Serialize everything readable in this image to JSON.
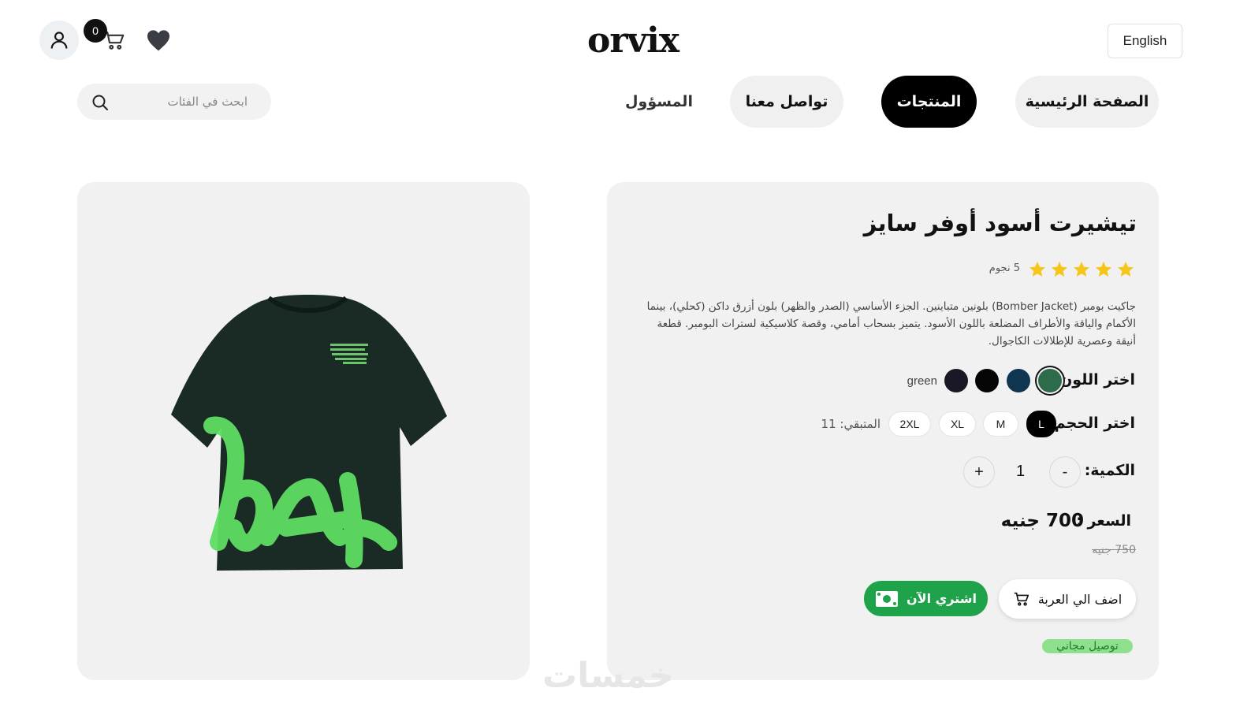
{
  "header": {
    "cart_count": "0",
    "logo": "orvix",
    "language": "English"
  },
  "nav": {
    "home": "الصفحة الرئيسية",
    "products": "المنتجات",
    "contact": "تواصل معنا",
    "admin": "المسؤول",
    "active": "products"
  },
  "search": {
    "placeholder": "ابحث في الفئات"
  },
  "product": {
    "title": "تيشيرت أسود أوفر سايز",
    "rating": 5,
    "rating_text": "5 نجوم",
    "description": "جاكيت بومبر (Bomber Jacket) بلونين متباينين. الجزء الأساسي (الصدر والظهر) بلون أزرق داكن (كحلي)، بينما الأكمام والياقة والأطراف المضلعة باللون الأسود. يتميز بسحاب أمامي، وقصة كلاسيكية لسترات البومبر. قطعة أنيقة وعصرية للإطلالات الكاجوال.",
    "color_label": "اختر اللون :",
    "colors": [
      {
        "name": "green",
        "hex": "#2e6b4a",
        "selected": true
      },
      {
        "name": "navy",
        "hex": "#0f3550",
        "selected": false
      },
      {
        "name": "black",
        "hex": "#050505",
        "selected": false
      },
      {
        "name": "dark",
        "hex": "#1a1826",
        "selected": false
      }
    ],
    "selected_color_name": "green",
    "size_label": "اختر الحجم :",
    "sizes": [
      "L",
      "M",
      "XL",
      "2XL"
    ],
    "selected_size": "L",
    "stock_text": "المتبقي: 11",
    "quantity_label": "الكمية:",
    "quantity": "1",
    "minus": "-",
    "plus": "+",
    "price_label": "السعر :",
    "price": "700 جنيه",
    "old_price": "750 جنيه",
    "add_to_cart": "اضف الي العربة",
    "buy_now": "اشتري الآن",
    "free_shipping": "توصيل مجاني",
    "tshirt_print": "I Let's All The Road The Mess"
  },
  "watermark": "خمسات",
  "colors": {
    "accent_black": "#000000",
    "buy_green": "#1fa34a",
    "card_bg": "#f1f1f1",
    "star_yellow": "#f5c518"
  }
}
